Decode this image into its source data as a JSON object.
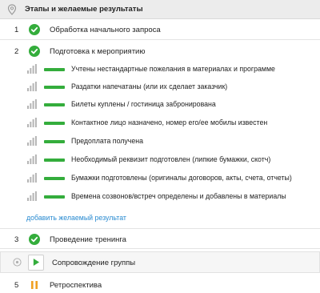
{
  "header": {
    "title": "Этапы и желаемые результаты",
    "icon": "location-pin-icon"
  },
  "colors": {
    "accent_green": "#34ad3c",
    "link_blue": "#2a8bd1",
    "pause_orange": "#f0a022"
  },
  "stages": [
    {
      "number": "1",
      "label": "Обработка начального запроса",
      "status": "done"
    },
    {
      "number": "2",
      "label": "Подготовка к мероприятию",
      "status": "done"
    },
    {
      "number": "3",
      "label": "Проведение тренинга",
      "status": "done"
    },
    {
      "number": "",
      "label": "Сопровождение группы",
      "status": "in-progress"
    },
    {
      "number": "5",
      "label": "Ретроспектива",
      "status": "paused"
    }
  ],
  "results": [
    {
      "text": "Учтены нестандартные пожелания в материалах и программе"
    },
    {
      "text": "Раздатки напечатаны (или их сделает заказчик)"
    },
    {
      "text": "Билеты куплены / гостиница забронирована"
    },
    {
      "text": "Контактное лицо назначено, номер его/ее мобилы известен"
    },
    {
      "text": "Предоплата получена"
    },
    {
      "text": "Необходимый реквизит подготовлен (липкие бумажки, скотч)"
    },
    {
      "text": "Бумажки подготовлены (оригиналы договоров, акты, счета, отчеты)"
    },
    {
      "text": "Времена созвонов/встреч определены и добавлены в материалы"
    }
  ],
  "add_result_link": "добавить желаемый результат"
}
